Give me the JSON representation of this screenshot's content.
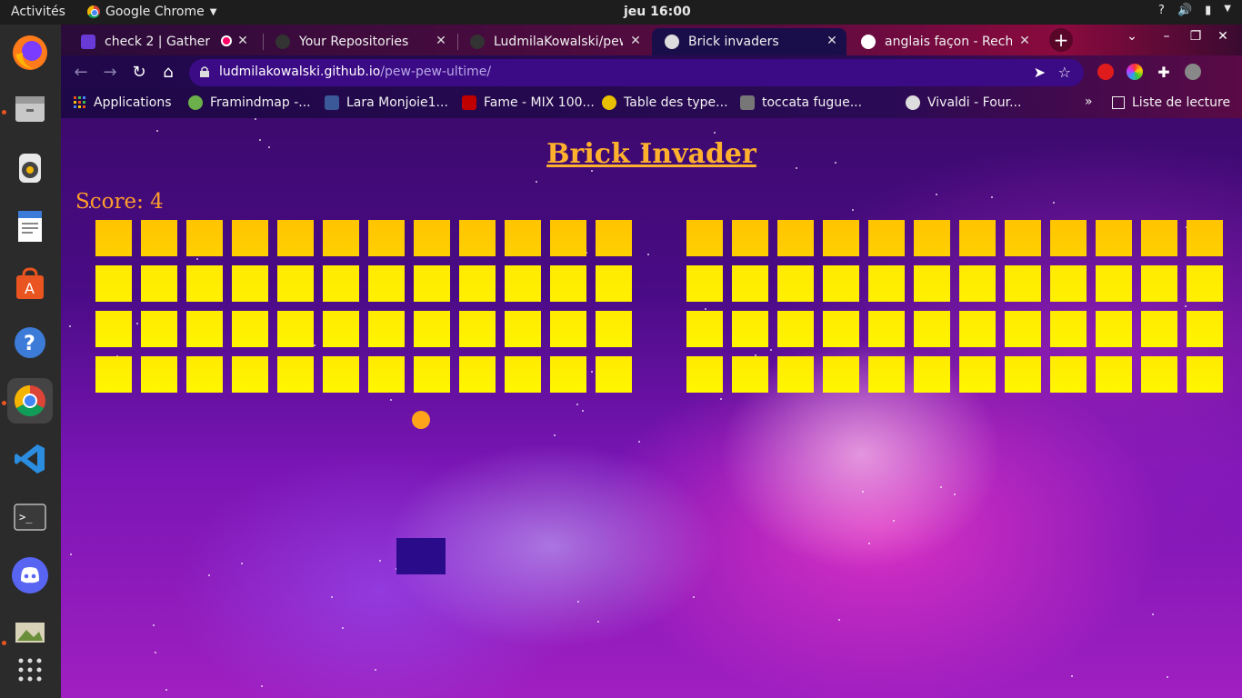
{
  "system": {
    "activities": "Activités",
    "app_name": "Google Chrome",
    "clock": "jeu 16:00",
    "tray_help": "?"
  },
  "browser": {
    "tabs": [
      {
        "title": "check 2 | Gather",
        "fav_color": "#6a3ad6"
      },
      {
        "title": "Your Repositories",
        "fav_color": "#333333"
      },
      {
        "title": "LudmilaKowalski/pew",
        "fav_color": "#333333"
      },
      {
        "title": "Brick invaders",
        "fav_color": "#dddddd"
      },
      {
        "title": "anglais façon - Recher",
        "fav_color": "#4285f4"
      }
    ],
    "active_tab": 3,
    "url_host": "ludmilakowalski.github.io",
    "url_path": "/pew-pew-ultime/",
    "bookmarks": [
      {
        "label": "Applications",
        "color": "#e94e1b"
      },
      {
        "label": "Framindmap -...",
        "color": "#6bb04a"
      },
      {
        "label": "Lara Monjoie1...",
        "color": "#3b5998"
      },
      {
        "label": "Fame - MIX 100...",
        "color": "#c00000"
      },
      {
        "label": "Table des type...",
        "color": "#e8c000"
      },
      {
        "label": "toccata fugue...",
        "color": "#777777"
      },
      {
        "label": "Vivaldi - Four...",
        "color": "#dddddd"
      }
    ],
    "reading_list": "Liste de lecture",
    "overflow": "»"
  },
  "game": {
    "title": "Brick Invader",
    "score_text": "Score: 4",
    "brick_rows": 4,
    "brick_cols_per_block": 12,
    "brick_colors": [
      "#ffd000",
      "#fff000",
      "#fff500",
      "#fff700"
    ],
    "ball_color": "#ffa31a",
    "paddle_color": "#2a0c8a"
  }
}
